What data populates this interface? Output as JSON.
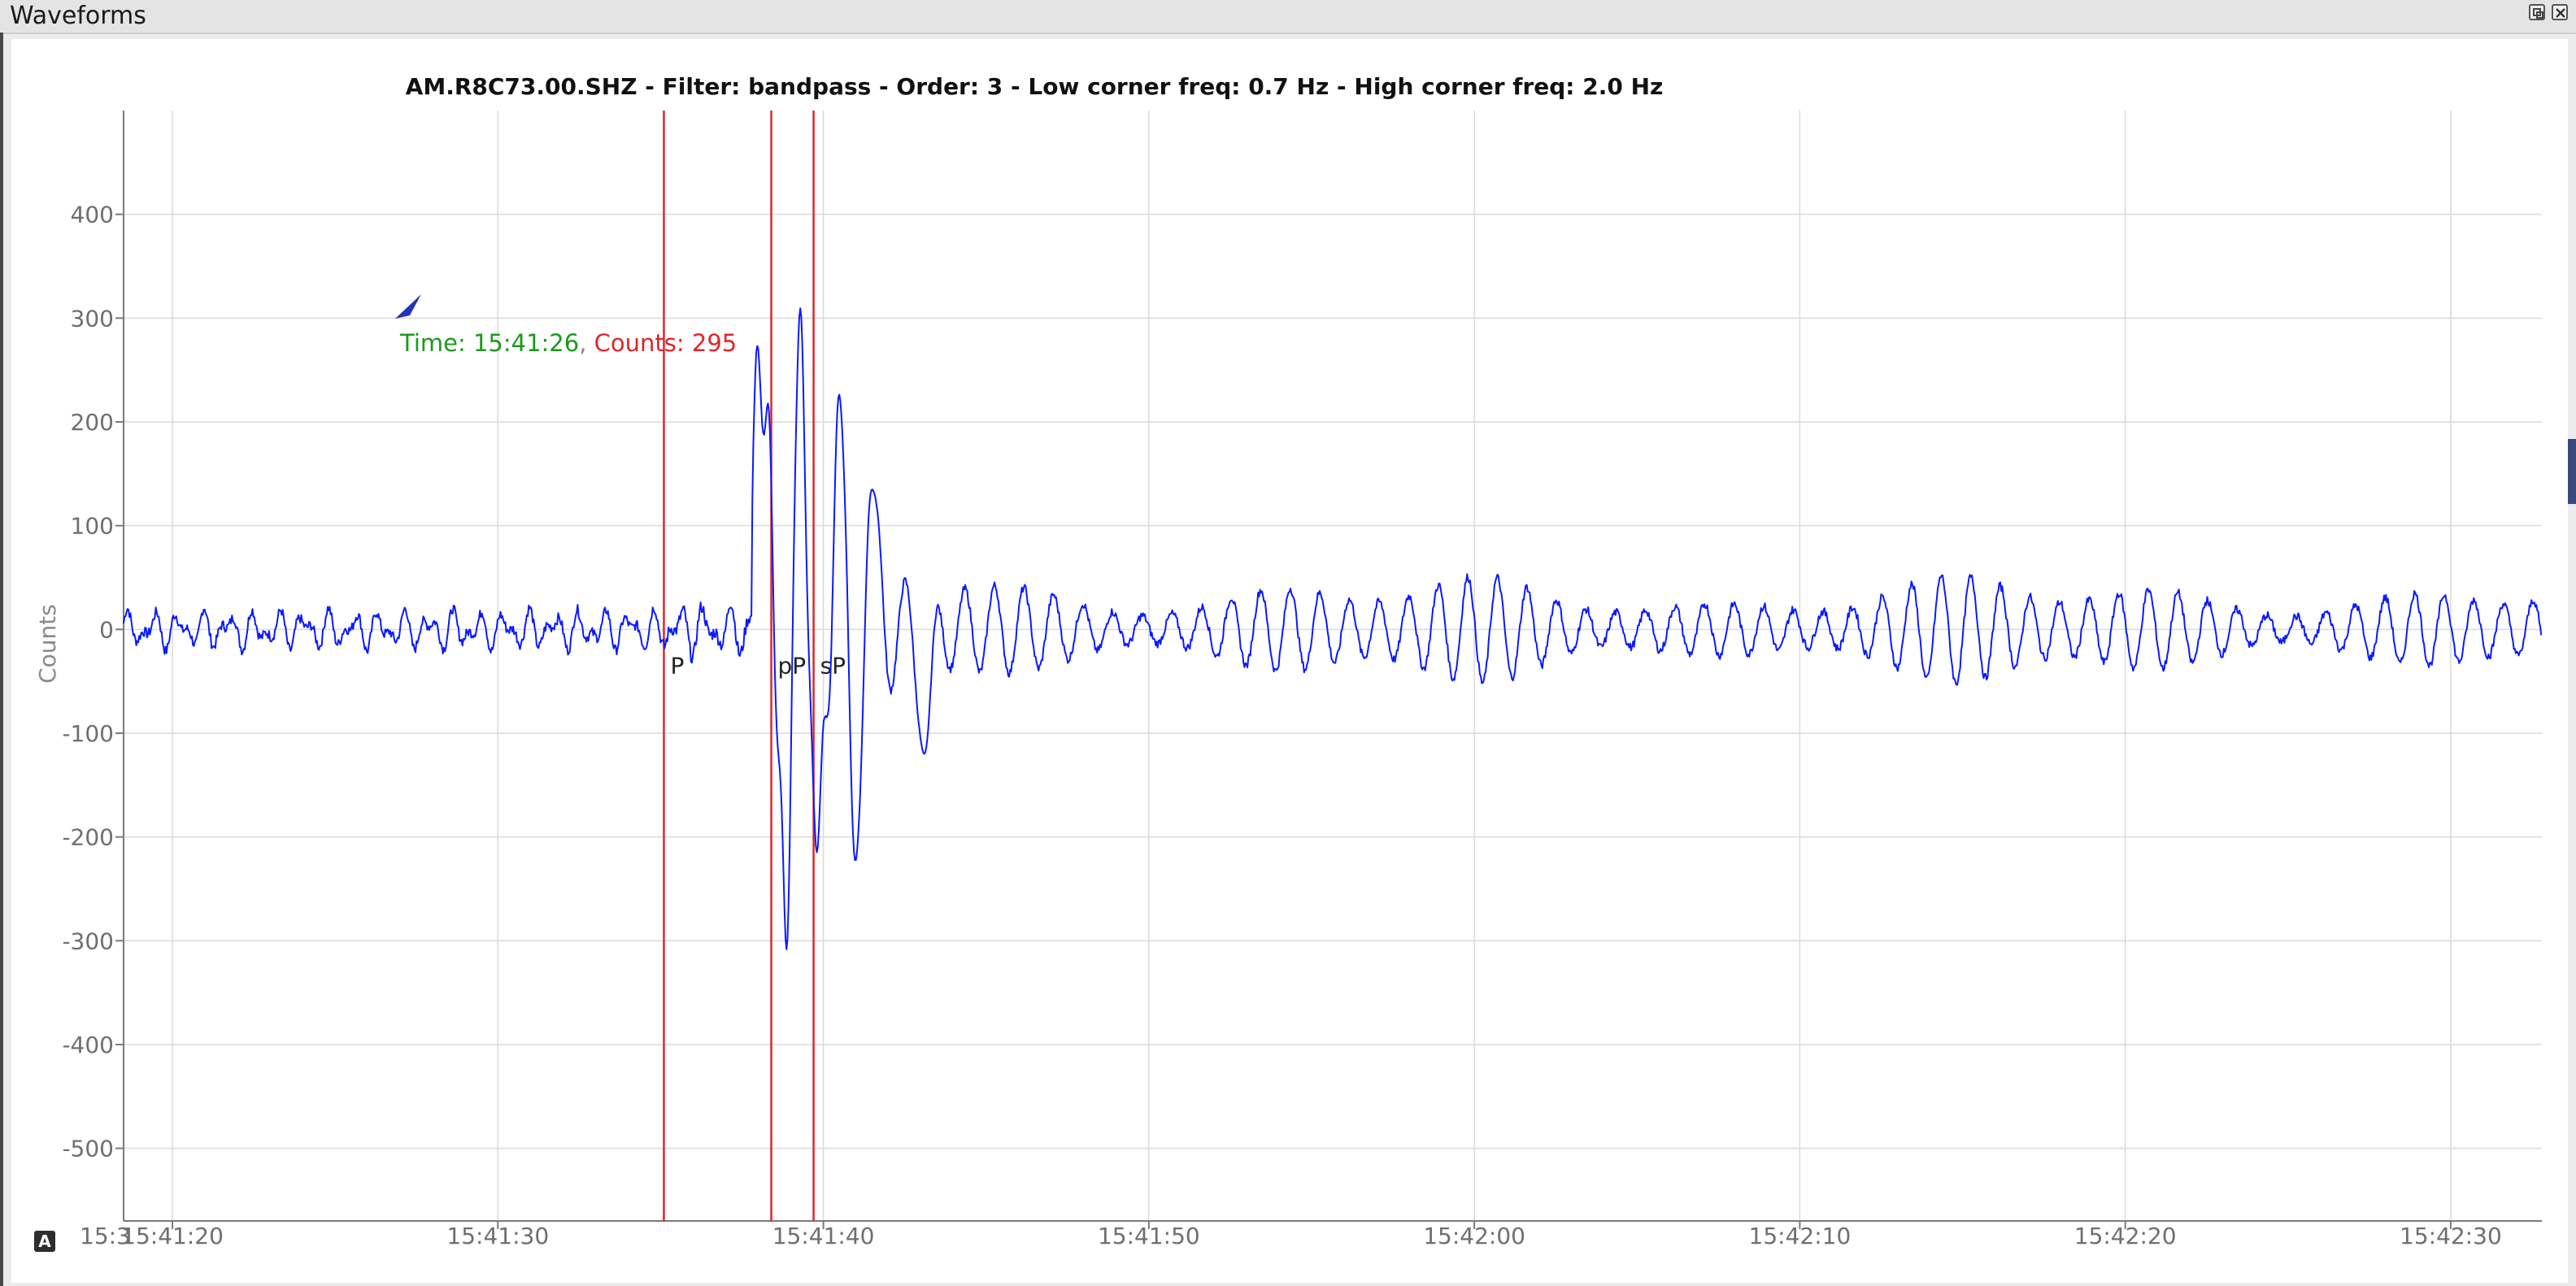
{
  "window": {
    "title": "Waveforms"
  },
  "icons": {
    "float": "float-window-icon",
    "close": "close-window-icon",
    "autoscale": "autoscale-icon",
    "cursor": "cursor-arrow-icon"
  },
  "colors": {
    "trace": "#0a1aff",
    "pick_line": "#e0262b",
    "time_readout": "#1a9a1a",
    "counts_readout": "#e0262b"
  },
  "chart_data": {
    "type": "line",
    "title": "AM.R8C73.00.SHZ - Filter: bandpass - Order: 3 - Low corner freq: 0.7 Hz - High corner freq: 2.0 Hz",
    "ylabel": "Counts",
    "xlabel": "",
    "ylim": [
      -570,
      500
    ],
    "xlim_seconds_after_15_41_00": [
      18.5,
      92.8
    ],
    "yticks": [
      "400",
      "300",
      "200",
      "100",
      "0",
      "-100",
      "-200",
      "-300",
      "-400",
      "-500"
    ],
    "xticks": [
      "15:41:20",
      "15:41:30",
      "15:41:40",
      "15:41:50",
      "15:42:00",
      "15:42:10",
      "15:42:20",
      "15:42:30"
    ],
    "x_axis_left_label_clipped": "15:3",
    "picks": [
      {
        "label": "P",
        "time": "15:41:35.1"
      },
      {
        "label": "pP",
        "time": "15:41:38.4"
      },
      {
        "label": "sP",
        "time": "15:41:39.7"
      }
    ],
    "cursor_readout": {
      "time_label": "Time: 15:41:26",
      "counts_label": "Counts: 295",
      "time": "15:41:26",
      "counts": 295
    },
    "series": [
      {
        "notable_extrema": [
          {
            "time": "15:41:38.3",
            "counts": 220
          },
          {
            "time": "15:41:38.9",
            "counts": -355
          },
          {
            "time": "15:41:39.3",
            "counts": 320
          },
          {
            "time": "15:41:39.8",
            "counts": -215
          },
          {
            "time": "15:41:40.5",
            "counts": 235
          },
          {
            "time": "15:41:41.0",
            "counts": -230
          },
          {
            "time": "15:41:41.5",
            "counts": 135
          },
          {
            "time": "15:41:43.1",
            "counts": -120
          }
        ]
      }
    ]
  },
  "footer": {
    "autoscale_label": "A"
  }
}
